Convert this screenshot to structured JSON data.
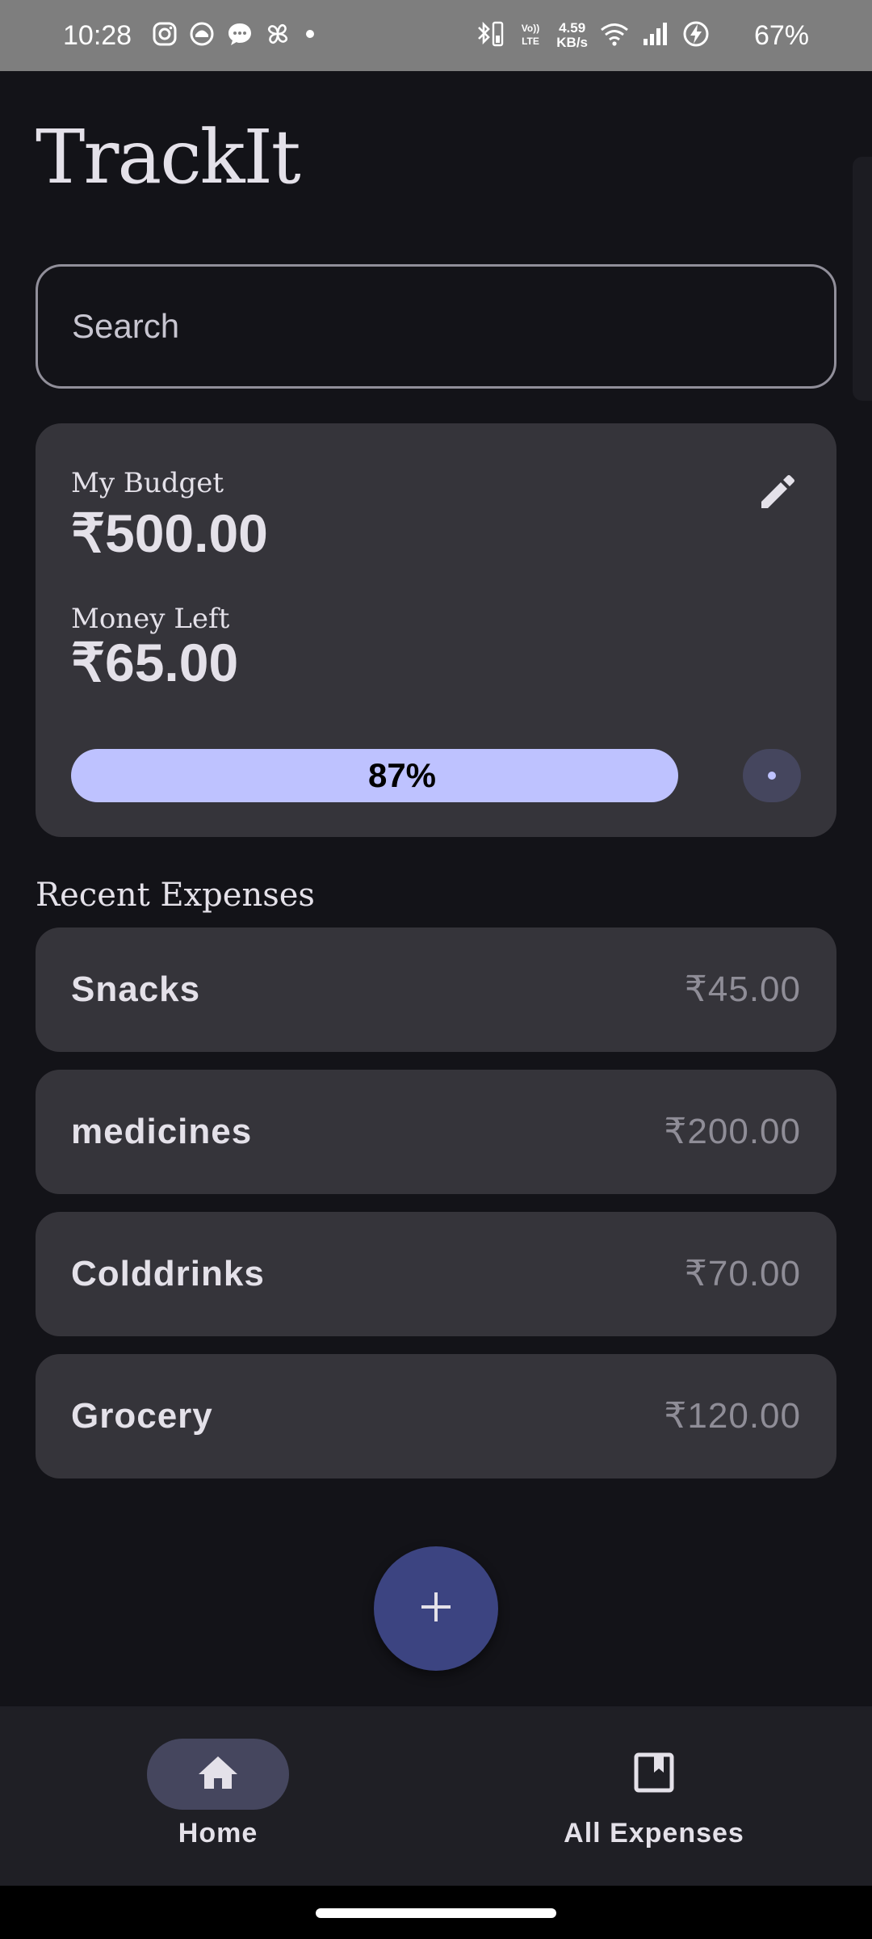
{
  "status_bar": {
    "time": "10:28",
    "left_icons": [
      "instagram-icon",
      "app-icon",
      "messages-icon",
      "pinwheel-icon",
      "dot-icon"
    ],
    "right_icons": [
      "bluetooth-icon",
      "volte-lte-icon",
      "wifi-icon",
      "signal-icon",
      "battery-charging-icon"
    ],
    "volte_label": "Vo))",
    "lte_label": "LTE",
    "net_speed_value": "4.59",
    "net_speed_unit": "KB/s",
    "battery_percent": "67%"
  },
  "app": {
    "title": "TrackIt"
  },
  "search": {
    "placeholder": "Search",
    "value": ""
  },
  "budget": {
    "budget_label": "My Budget",
    "budget_amount": "₹500.00",
    "money_left_label": "Money Left",
    "money_left_amount": "₹65.00",
    "progress_text": "87%",
    "progress_fraction": 0.87,
    "edit_icon": "pencil-icon"
  },
  "recent_expenses": {
    "title": "Recent Expenses",
    "items": [
      {
        "name": "Snacks",
        "amount": "₹45.00"
      },
      {
        "name": "medicines",
        "amount": "₹200.00"
      },
      {
        "name": "Colddrinks",
        "amount": "₹70.00"
      },
      {
        "name": "Grocery",
        "amount": "₹120.00"
      }
    ]
  },
  "fab": {
    "icon": "plus-icon"
  },
  "bottom_nav": {
    "items": [
      {
        "label": "Home",
        "icon": "home-icon",
        "active": true
      },
      {
        "label": "All Expenses",
        "icon": "bookmark-icon",
        "active": false
      }
    ]
  },
  "colors": {
    "background": "#131318",
    "card": "#35343a",
    "accent": "#bec2ff",
    "fab": "#3c4481",
    "nav_background": "#1f1f25",
    "nav_active_pill": "#45465e",
    "text_primary": "#e4e1e9",
    "text_muted": "#8f8d97"
  }
}
